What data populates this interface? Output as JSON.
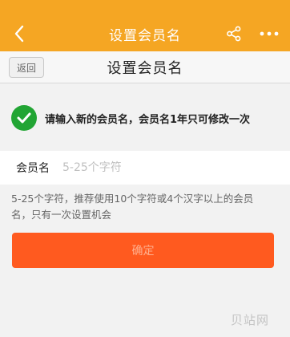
{
  "nav": {
    "title": "设置会员名",
    "back_icon": "chevron-left-icon",
    "share_icon": "share-icon",
    "more_icon": "more-dots-icon"
  },
  "sub_header": {
    "back_label": "返回",
    "title": "设置会员名"
  },
  "notice": {
    "icon": "check-circle-icon",
    "text": "请输入新的会员名，会员名1年只可修改一次"
  },
  "field": {
    "label": "会员名",
    "placeholder": "5-25个字符",
    "value": ""
  },
  "hint": "5-25个字符，推荐使用10个字符或4个汉字以上的会员名，只有一次设置机会",
  "confirm_label": "确定",
  "watermark": "贝站网",
  "colors": {
    "nav_bg": "#f5a623",
    "confirm_bg": "#ff5a1f",
    "check_green": "#22a534"
  }
}
